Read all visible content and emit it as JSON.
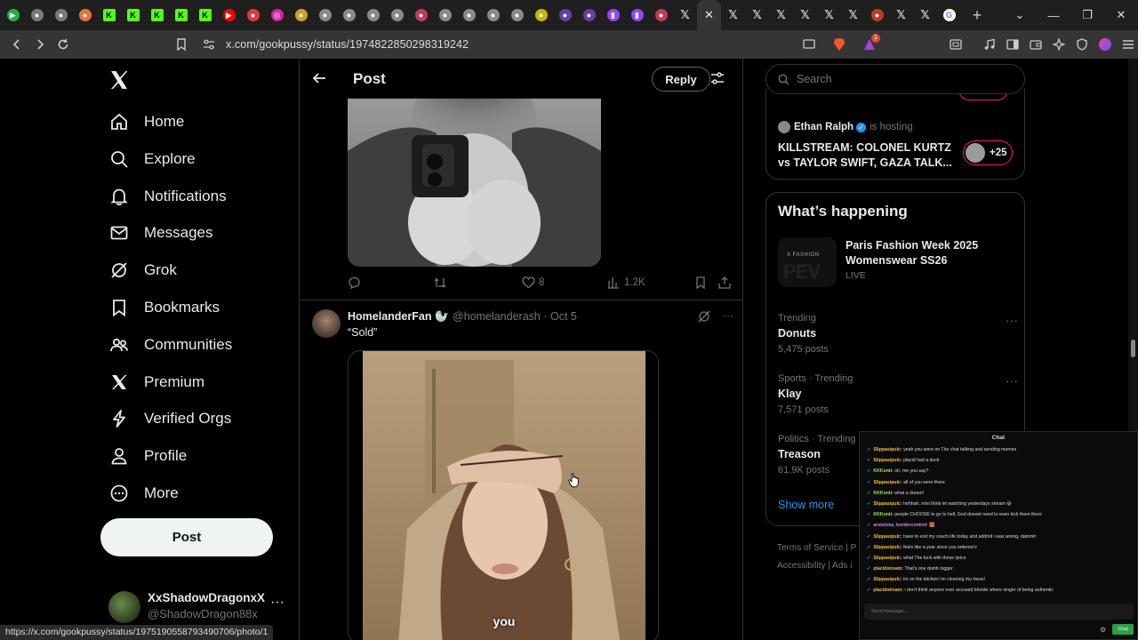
{
  "browser": {
    "tabs": [
      {
        "icon": "green-play-icon",
        "color": "#1fb141"
      },
      {
        "icon": "gray-circle-icon",
        "color": "#7a7a7a"
      },
      {
        "icon": "gray-circle-icon",
        "color": "#7a7a7a"
      },
      {
        "icon": "ring-icon",
        "color": "#e8743b"
      },
      {
        "icon": "kick-icon",
        "color": "#53fc18"
      },
      {
        "icon": "kick-icon",
        "color": "#53fc18"
      },
      {
        "icon": "kick-icon",
        "color": "#53fc18"
      },
      {
        "icon": "kick-icon",
        "color": "#53fc18"
      },
      {
        "icon": "kick-icon",
        "color": "#53fc18"
      },
      {
        "icon": "youtube-icon",
        "color": "#ff0000"
      },
      {
        "icon": "red-swirl-icon",
        "color": "#e03a3a"
      },
      {
        "icon": "instagram-icon",
        "color": "#d6249f"
      },
      {
        "icon": "yellow-icon",
        "color": "#c9a227"
      },
      {
        "icon": "gray-circle-icon",
        "color": "#8a8a8a"
      },
      {
        "icon": "gray-circle-icon",
        "color": "#8a8a8a"
      },
      {
        "icon": "gray-circle-icon",
        "color": "#8a8a8a"
      },
      {
        "icon": "gray-circle-icon",
        "color": "#8a8a8a"
      },
      {
        "icon": "red-circle-icon",
        "color": "#c23a5a"
      },
      {
        "icon": "gray-circle-icon",
        "color": "#8a8a8a"
      },
      {
        "icon": "gray-circle-icon",
        "color": "#8a8a8a"
      },
      {
        "icon": "gray-circle-icon",
        "color": "#8a8a8a"
      },
      {
        "icon": "gray-circle-icon",
        "color": "#8a8a8a"
      },
      {
        "icon": "yellow-icon",
        "color": "#c9b600"
      },
      {
        "icon": "purple-circle-icon",
        "color": "#6441a5"
      },
      {
        "icon": "purple-circle-icon",
        "color": "#6441a5"
      },
      {
        "icon": "twitch-icon",
        "color": "#9146ff"
      },
      {
        "icon": "twitch-icon",
        "color": "#9146ff"
      },
      {
        "icon": "red-circle-icon",
        "color": "#c23a5a"
      },
      {
        "icon": "x-icon",
        "color": "#e7e9ea"
      },
      {
        "icon": "close-icon",
        "color": "#e7e9ea",
        "active": true
      },
      {
        "icon": "x-icon",
        "color": "#e7e9ea"
      },
      {
        "icon": "x-icon",
        "color": "#e7e9ea"
      },
      {
        "icon": "x-icon",
        "color": "#e7e9ea"
      },
      {
        "icon": "x-icon",
        "color": "#e7e9ea"
      },
      {
        "icon": "x-icon",
        "color": "#e7e9ea"
      },
      {
        "icon": "x-icon",
        "color": "#e7e9ea"
      },
      {
        "icon": "red-circle-icon",
        "color": "#c0392b"
      },
      {
        "icon": "x-icon",
        "color": "#e7e9ea"
      },
      {
        "icon": "x-icon",
        "color": "#e7e9ea"
      },
      {
        "icon": "google-icon",
        "color": "#4285f4"
      }
    ],
    "url": "x.com/gookpussy/status/1974822850298319242",
    "status_url": "https://x.com/gookpussy/status/1975190558793490706/photo/1",
    "brave_badge": "1"
  },
  "nav": {
    "items": [
      {
        "label": "Home",
        "icon": "home-icon"
      },
      {
        "label": "Explore",
        "icon": "search-icon"
      },
      {
        "label": "Notifications",
        "icon": "bell-icon"
      },
      {
        "label": "Messages",
        "icon": "envelope-icon"
      },
      {
        "label": "Grok",
        "icon": "grok-icon"
      },
      {
        "label": "Bookmarks",
        "icon": "bookmark-icon"
      },
      {
        "label": "Communities",
        "icon": "communities-icon"
      },
      {
        "label": "Premium",
        "icon": "x-logo-icon"
      },
      {
        "label": "Verified Orgs",
        "icon": "lightning-icon"
      },
      {
        "label": "Profile",
        "icon": "person-icon"
      },
      {
        "label": "More",
        "icon": "more-circle-icon"
      }
    ],
    "post_label": "Post",
    "account": {
      "name": "XxShadowDragonxX",
      "handle": "@ShadowDragon88x"
    }
  },
  "header": {
    "title": "Post",
    "reply_label": "Reply"
  },
  "tweet1": {
    "likes": "8",
    "views": "1.2K"
  },
  "tweet2": {
    "name": "HomelanderFan",
    "handle": "@homelanderash · Oct 5",
    "text": "“Sold”",
    "caption": "you"
  },
  "right": {
    "search_placeholder": "Search",
    "space": {
      "host": "Ethan Ralph",
      "hosting": "is hosting",
      "title": "KILLSTREAM: COLONEL KURTZ vs TAYLOR SWIFT, GAZA TALK...",
      "listeners": "+25"
    },
    "happening": {
      "title": "What’s happening",
      "event": {
        "title": "Paris Fashion Week 2025 Womenswear SS26",
        "status": "LIVE",
        "image_text": "X FASHION"
      },
      "trends": [
        {
          "context": "Trending",
          "name": "Donuts",
          "posts": "5,475 posts"
        },
        {
          "context": "Sports · Trending",
          "name": "Klay",
          "posts": "7,571 posts"
        },
        {
          "context": "Politics · Trending",
          "name": "Treason",
          "posts": "61.9K posts"
        }
      ],
      "show_more": "Show more"
    },
    "footer": {
      "line1": "Terms of Service  |  P",
      "line2": "Accessibility  |  Ads i"
    }
  },
  "chat": {
    "title": "Chat",
    "messages": [
      {
        "user": "Slippasipulc",
        "text": "yeah you were on The chat talking and sending memes",
        "c": "u1"
      },
      {
        "user": "Slippasipulc",
        "text": "placid had a duck",
        "c": "u1"
      },
      {
        "user": "KKKonti",
        "text": "oh, me you say?",
        "c": "u2"
      },
      {
        "user": "Slippasipulc",
        "text": "all of you were there",
        "c": "u1"
      },
      {
        "user": "KKKonti",
        "text": "what a dream!",
        "c": "u2"
      },
      {
        "user": "Slippasipulc",
        "text": "hehhah, mini think im watching yesterdays stream 😄",
        "c": "u1"
      },
      {
        "user": "KKKonti",
        "text": "people CHOOSE to go to hell, God doesnt need to even kick them there",
        "c": "u2"
      },
      {
        "user": "arstotzka_bordercontrol",
        "text": "🟫",
        "c": "u3"
      },
      {
        "user": "Slippasipulc",
        "text": "have to end my couch life today and addmit i was wrong, dammit",
        "c": "u1"
      },
      {
        "user": "Slippasipulc",
        "text": "feels like a year since you ordered ir",
        "c": "u1"
      },
      {
        "user": "Slippasipulc",
        "text": "what The fuck with those lyrics",
        "c": "u1"
      },
      {
        "user": "placidstream",
        "text": "That's one dumb nigger",
        "c": "u1"
      },
      {
        "user": "Slippasipulc",
        "text": "im on the kitchen! im cleaning my mess!",
        "c": "u1"
      },
      {
        "user": "placidstream",
        "text": "i don't think anyone ever accused blonde whore singer of being authentic",
        "c": "u1"
      }
    ],
    "input_placeholder": "Send message...",
    "send_label": "Chat"
  }
}
